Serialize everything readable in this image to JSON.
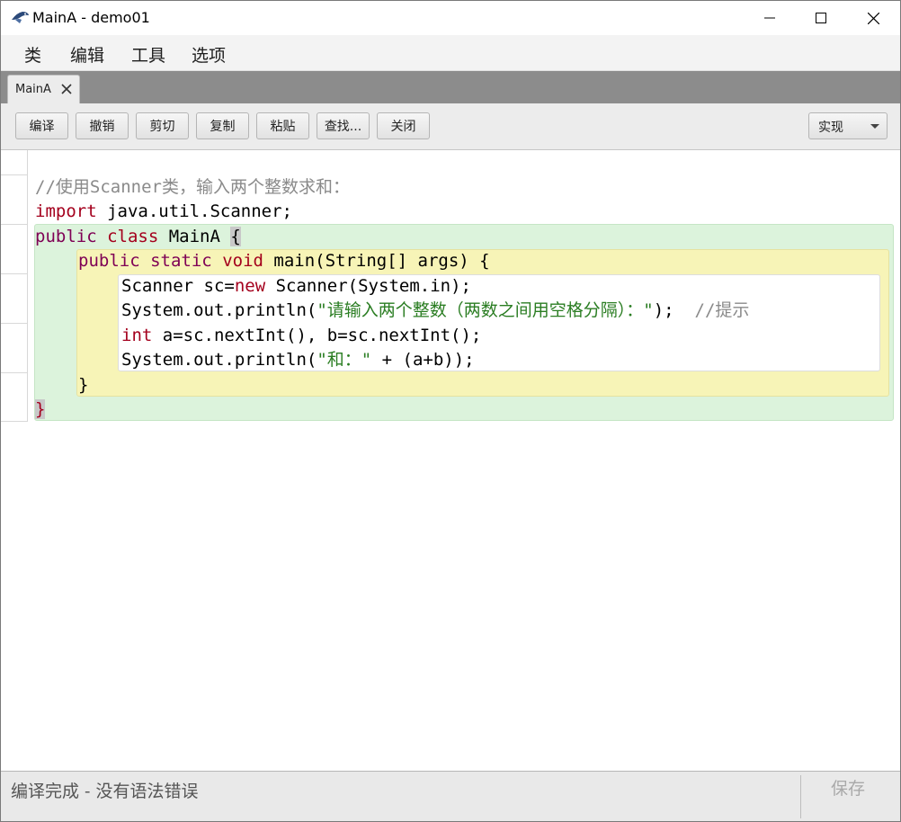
{
  "window": {
    "title": "MainA - demo01"
  },
  "menu": [
    "类",
    "编辑",
    "工具",
    "选项"
  ],
  "tabs": [
    {
      "label": "MainA"
    }
  ],
  "toolbar": {
    "buttons": [
      "编译",
      "撤销",
      "剪切",
      "复制",
      "粘贴",
      "查找...",
      "关闭"
    ],
    "view_select": "实现"
  },
  "code": {
    "comment_line": "//使用Scanner类，输入两个整数求和：",
    "import_kw": "import",
    "import_rest": " java.util.Scanner;",
    "class_public": "public",
    "class_kw": "class",
    "class_name": " MainA ",
    "open_brace": "{",
    "method_public": "public",
    "method_static": "static",
    "method_void": "void",
    "method_sig": " main(String[] args) {",
    "line1_a": "Scanner sc=",
    "line1_new": "new",
    "line1_b": " Scanner(System.in);",
    "line2_a": "System.out.println(",
    "line2_str": "\"请输入两个整数（两数之间用空格分隔）：\"",
    "line2_b": ");  ",
    "line2_cmt": "//提示",
    "line3_int": "int",
    "line3_rest": " a=sc.nextInt(), b=sc.nextInt();",
    "line4_a": "System.out.println(",
    "line4_str": "\"和：\"",
    "line4_b": " + (a+b));",
    "method_close": "}",
    "class_close": "}"
  },
  "status": {
    "message": "编译完成 - 没有语法错误",
    "save_label": "保存"
  },
  "colors": {
    "keyword": "#a4001d",
    "string": "#2a7d22",
    "comment": "#8a8a8a",
    "class_block": "#dcf3dc",
    "method_block": "#f7f4b7"
  }
}
